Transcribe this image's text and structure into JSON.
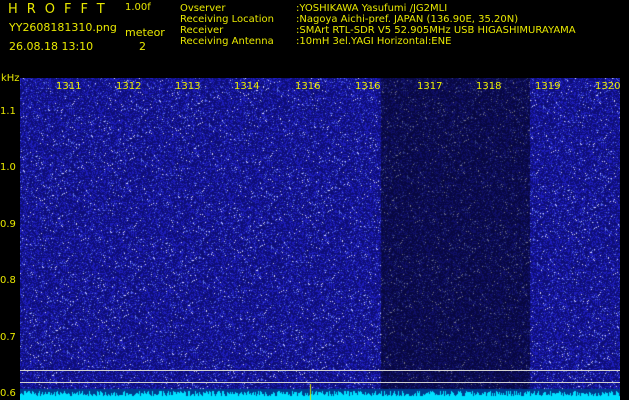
{
  "header": {
    "logo": "HROFFT",
    "version": "1.00f",
    "filename": "YY2608181310.png",
    "datetime": "26.08.18 13:10",
    "meteor_label": "meteor",
    "meteor_count": "2",
    "info": [
      {
        "label": "Ovserver",
        "value": ":YOSHIKAWA Yasufumi /JG2MLI"
      },
      {
        "label": "Receiving Location",
        "value": ":Nagoya Aichi-pref. JAPAN (136.90E, 35.20N)"
      },
      {
        "label": "Receiver",
        "value": ":SMArt RTL-SDR V5 52.905MHz USB HIGASHIMURAYAMA"
      },
      {
        "label": "Receiving Antenna",
        "value": ":10mH 3el.YAGI Horizontal:ENE"
      }
    ]
  },
  "colors": {
    "background": "#000000",
    "text": "#e8e800",
    "spectrogram": "#1414a8",
    "baseline": "#00e0ff"
  },
  "spectrogram": {
    "unit_label": "kHz",
    "minute_labels": [
      "1311",
      "1312",
      "1313",
      "1314",
      "1316",
      "1316",
      "1317",
      "1318",
      "1319",
      "1320"
    ],
    "y_ticks": [
      {
        "label": "1.1",
        "value": 1.1
      },
      {
        "label": "1.0",
        "value": 1.0
      },
      {
        "label": "0.9",
        "value": 0.9
      },
      {
        "label": "0.8",
        "value": 0.8
      },
      {
        "label": "0.7",
        "value": 0.7
      },
      {
        "label": "0.6",
        "value": 0.6
      }
    ],
    "y_top": 1.16,
    "y_bottom": 0.59
  }
}
